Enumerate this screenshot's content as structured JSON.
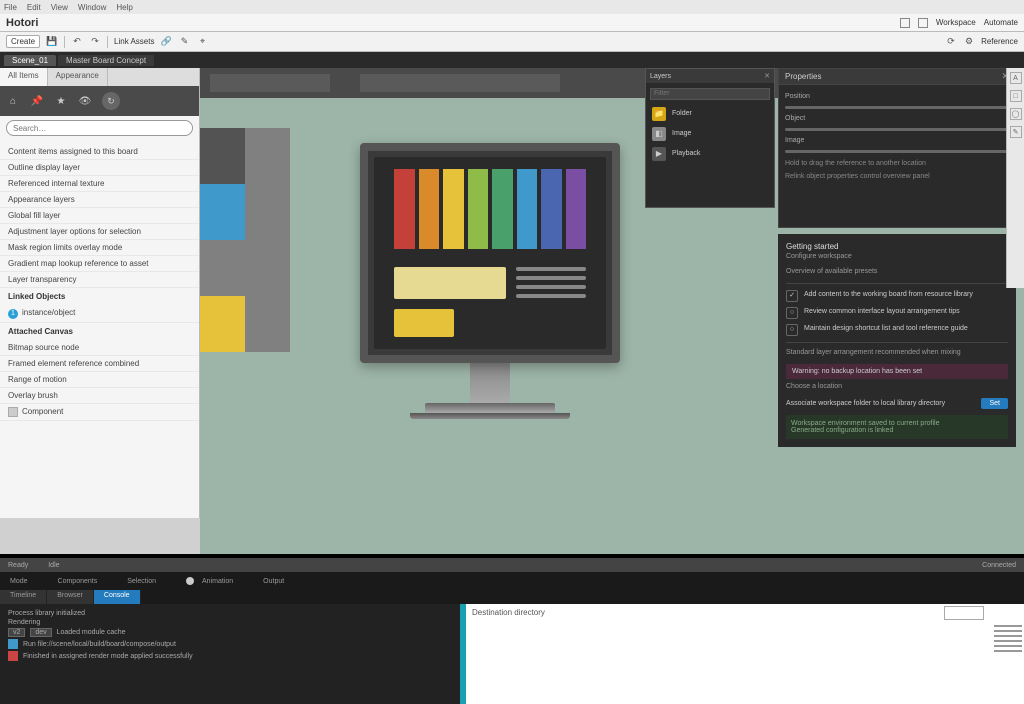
{
  "menubar": {
    "items": [
      "File",
      "Edit",
      "View",
      "Window",
      "Help"
    ]
  },
  "titlebar": {
    "app": "Hotori",
    "right": [
      "Workspace",
      "Automate"
    ]
  },
  "toolbar": {
    "create": "Create",
    "link": "Link Assets",
    "right_label": "Reference"
  },
  "tabstrip": {
    "tabs": [
      {
        "label": "Scene_01"
      },
      {
        "label": "Master Board Concept"
      }
    ]
  },
  "left_panel": {
    "tabs": [
      "All Items",
      "Appearance"
    ],
    "search_placeholder": "Search…",
    "list": [
      "Content items assigned to this board",
      "Outline display layer",
      "Referenced internal texture",
      "Appearance layers",
      "Global fill layer",
      "Adjustment layer options for selection",
      "Mask region limits overlay mode",
      "Gradient map lookup reference to asset",
      "Layer transparency"
    ],
    "section1": {
      "title": "Linked Objects",
      "badge": "1",
      "item": "instance/object"
    },
    "section2": {
      "title": "Attached Canvas",
      "items": [
        "Bitmap source node",
        "Framed element reference combined",
        "Range of motion",
        "Overlay brush"
      ],
      "thumb_item": "Component"
    }
  },
  "float_panel": {
    "title": "Layers",
    "search_placeholder": "Filter",
    "items": [
      {
        "icon": "📁",
        "color": "#d6a615",
        "label": "Folder"
      },
      {
        "icon": "◧",
        "color": "#888",
        "label": "Image"
      },
      {
        "icon": "▶",
        "color": "#ccc",
        "label": "Playback"
      }
    ]
  },
  "props_panel": {
    "title": "Properties",
    "fields": [
      "Position",
      "Object",
      "Image"
    ],
    "note1": "Hold to drag the reference to another location",
    "note2": "Relink object properties control overview panel"
  },
  "task_panel": {
    "group_title": "Getting started",
    "group_sub": "Configure workspace",
    "group_sub2": "Overview of available presets",
    "tasks": [
      "Add content to the working board from resource library",
      "Review common interface layout arrangement tips",
      "Maintain design shortcut list and tool reference guide"
    ],
    "hint": "Standard layer arrangement recommended when mixing",
    "pill": "Warning: no backup location has been set",
    "cta_label": "Set",
    "cta_text": "Choose a location",
    "cta_hint": "Associate workspace folder to local library directory",
    "foot1": "Workspace environment saved to current profile",
    "foot2": "Generated configuration is linked"
  },
  "bottom": {
    "status": {
      "left": [
        "Ready",
        "Idle"
      ],
      "right": "Connected"
    },
    "tool_row": [
      "Mode",
      "Components",
      "Selection",
      "Animation",
      "Output"
    ],
    "sub_tabs": [
      "Timeline",
      "Browser",
      "Console"
    ],
    "log": {
      "l1": "Process library initialized",
      "l2": "Rendering",
      "l3_chips": [
        "v2",
        "dev"
      ],
      "l3": "Loaded module cache",
      "l4_pre": "Run",
      "l4": "file://scene/local/build/board/compose/output",
      "l5": "Finished in assigned render mode applied successfully"
    },
    "browser_field": "Destination directory"
  },
  "colors": {
    "swatches": [
      "#535353",
      "#808080",
      "#3f9acb",
      "#808080",
      "#808080",
      "#808080",
      "#e6c23a",
      "#808080"
    ],
    "rainbow": [
      "#c4413a",
      "#d98b2b",
      "#e6c23a",
      "#8fbb49",
      "#4aa06a",
      "#3f9acb",
      "#4a66b0",
      "#7a4fa3"
    ]
  }
}
